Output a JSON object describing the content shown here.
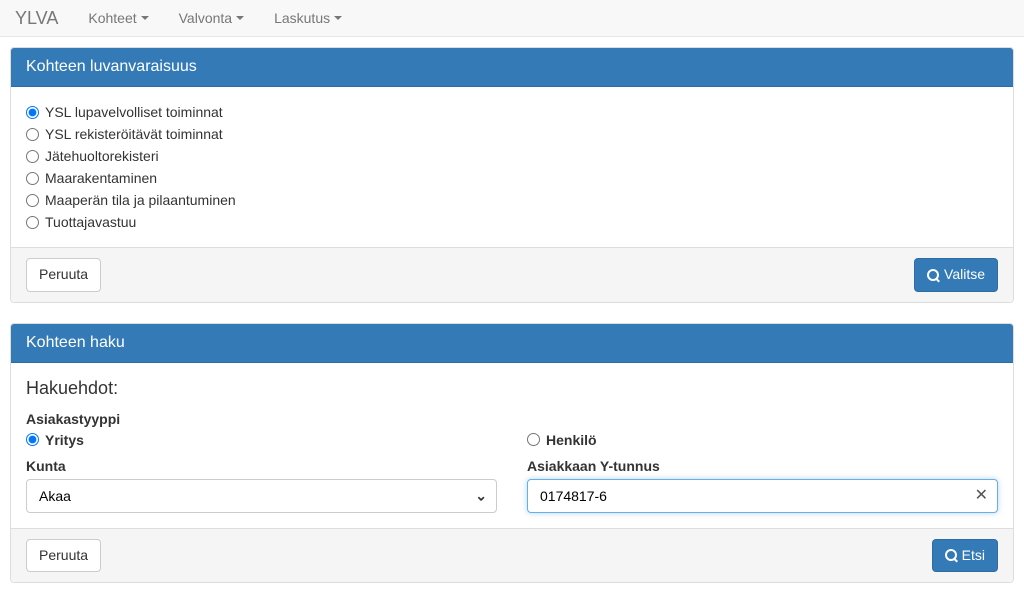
{
  "navbar": {
    "brand": "YLVA",
    "items": [
      "Kohteet",
      "Valvonta",
      "Laskutus"
    ]
  },
  "panel1": {
    "title": "Kohteen luvanvaraisuus",
    "options": {
      "o0": "YSL lupavelvolliset toiminnat",
      "o1": "YSL rekisteröitävät toiminnat",
      "o2": "Jätehuoltorekisteri",
      "o3": "Maarakentaminen",
      "o4": "Maaperän tila ja pilaantuminen",
      "o5": "Tuottajavastuu"
    },
    "cancel": "Peruuta",
    "submit": "Valitse"
  },
  "panel2": {
    "title": "Kohteen haku",
    "section": "Hakuehdot:",
    "asiakastyyppi_label": "Asiakastyyppi",
    "yritys": "Yritys",
    "henkilo": "Henkilö",
    "kunta_label": "Kunta",
    "kunta_value": "Akaa",
    "ytunnus_label": "Asiakkaan Y-tunnus",
    "ytunnus_value": "0174817-6",
    "cancel": "Peruuta",
    "submit": "Etsi"
  }
}
